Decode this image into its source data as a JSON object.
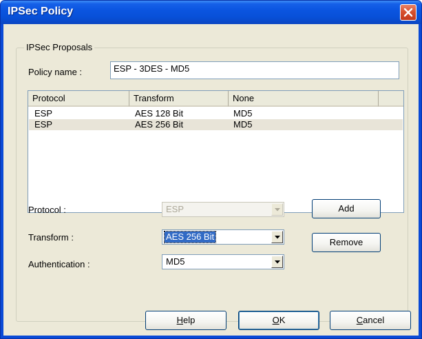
{
  "window": {
    "title": "IPSec Policy"
  },
  "group": {
    "legend": "IPSec Proposals"
  },
  "policy_name": {
    "label": "Policy name :",
    "value": "ESP - 3DES - MD5"
  },
  "proposals": {
    "columns": [
      "Protocol",
      "Transform",
      "None"
    ],
    "rows": [
      {
        "protocol": "ESP",
        "transform": "AES 128 Bit",
        "auth": "MD5"
      },
      {
        "protocol": "ESP",
        "transform": "AES 256 Bit",
        "auth": "MD5"
      }
    ]
  },
  "protocol": {
    "label": "Protocol :",
    "value": "ESP"
  },
  "transform": {
    "label": "Transform :",
    "value": "AES 256 Bit"
  },
  "authentication": {
    "label": "Authentication :",
    "value": "MD5"
  },
  "buttons": {
    "add": "Add",
    "remove": "Remove",
    "help_first": "H",
    "help_rest": "elp",
    "ok_first": "O",
    "ok_rest": "K",
    "cancel_first": "C",
    "cancel_rest": "ancel"
  },
  "colors": {
    "titlebar": "#0a4ad6",
    "dialog": "#ece9d8",
    "selection": "#316ac5",
    "close": "#d8512e"
  }
}
